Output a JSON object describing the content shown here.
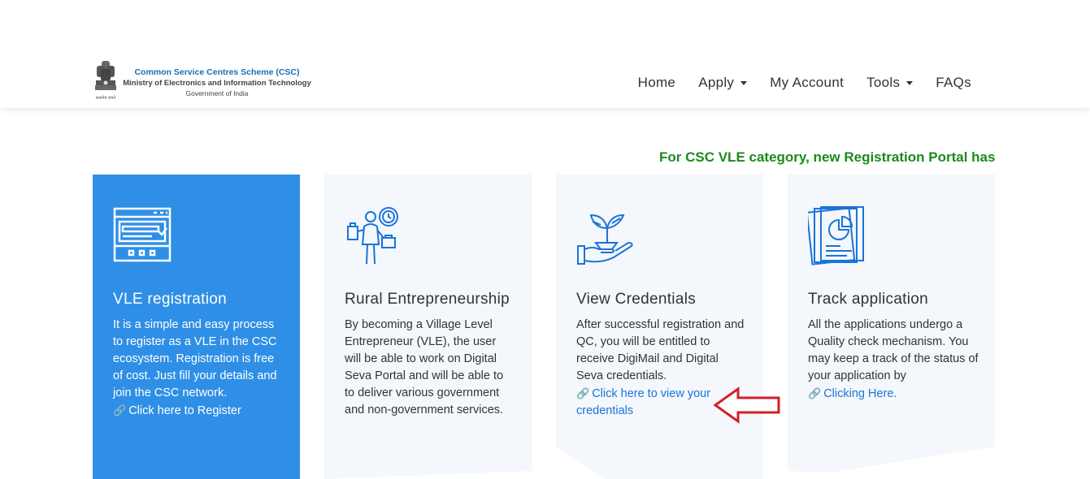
{
  "brand": {
    "line1": "Common Service Centres Scheme (CSC)",
    "line2": "Ministry of Electronics and Information Technology",
    "line3": "Government of India",
    "emblem_caption": "सत्यमेव जयते"
  },
  "nav": {
    "home": "Home",
    "apply": "Apply",
    "my_account": "My Account",
    "tools": "Tools",
    "faqs": "FAQs"
  },
  "marquee": "For CSC VLE category, new Registration Portal has l",
  "cards": [
    {
      "title": "VLE registration",
      "body": "It is a simple and easy process to register as a VLE in the CSC ecosystem. Registration is free of cost. Just fill your details and join the CSC network.",
      "link": "Click here to Register"
    },
    {
      "title": "Rural Entrepreneurship",
      "body": "By becoming a Village Level Entrepreneur (VLE), the user will be able to work on Digital Seva Portal and will be able to to deliver various government and non-government services."
    },
    {
      "title": "View Credentials",
      "body": "After successful registration and QC, you will be entitled to receive DigiMail and Digital Seva credentials.",
      "link": "Click here to view your credentials"
    },
    {
      "title": "Track application",
      "body": "All the applications undergo a Quality check mechanism. You may keep a track of the status of your application by",
      "link": "Clicking Here."
    }
  ],
  "colors": {
    "card_blue": "#2f8fe6",
    "card_light": "#f4f7fb",
    "link": "#1a73d9",
    "marquee": "#1c8a1c",
    "annotation_arrow": "#d0202a"
  }
}
